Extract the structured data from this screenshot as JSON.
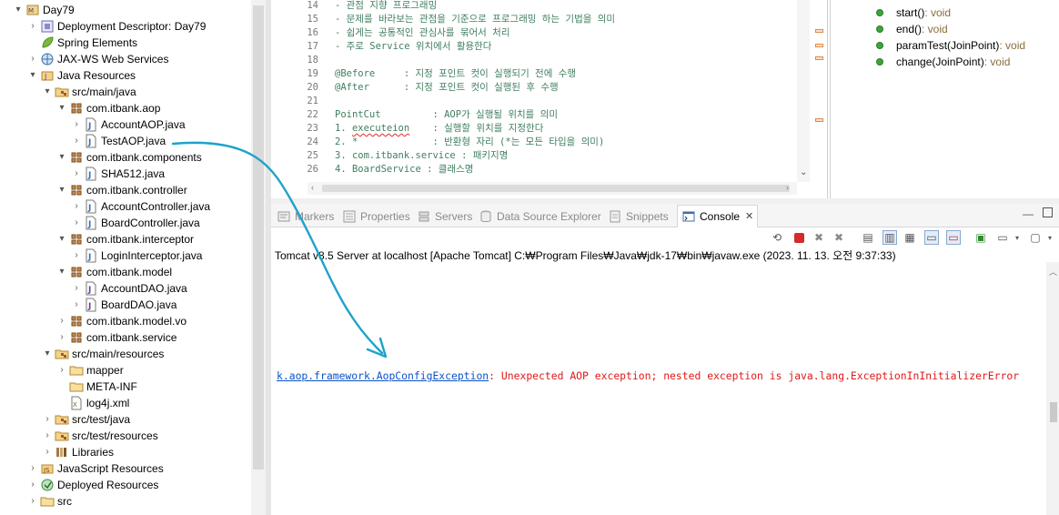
{
  "explorer": {
    "rows": [
      {
        "label": "Day79",
        "twisty": "▾",
        "icon": "project-icon"
      },
      {
        "label": "Deployment Descriptor: Day79",
        "twisty": "›",
        "icon": "deployment-descriptor-icon"
      },
      {
        "label": "Spring Elements",
        "twisty": "",
        "icon": "spring-leaf-icon"
      },
      {
        "label": "JAX-WS Web Services",
        "twisty": "›",
        "icon": "web-services-icon"
      },
      {
        "label": "Java Resources",
        "twisty": "▾",
        "icon": "java-resources-icon"
      },
      {
        "label": "src/main/java",
        "twisty": "▾",
        "icon": "source-folder-icon"
      },
      {
        "label": "com.itbank.aop",
        "twisty": "▾",
        "icon": "package-icon"
      },
      {
        "label": "AccountAOP.java",
        "twisty": "›",
        "icon": "java-file-icon"
      },
      {
        "label": "TestAOP.java",
        "twisty": "›",
        "icon": "java-file-icon"
      },
      {
        "label": "com.itbank.components",
        "twisty": "▾",
        "icon": "package-icon"
      },
      {
        "label": "SHA512.java",
        "twisty": "›",
        "icon": "java-file-icon"
      },
      {
        "label": "com.itbank.controller",
        "twisty": "▾",
        "icon": "package-icon"
      },
      {
        "label": "AccountController.java",
        "twisty": "›",
        "icon": "java-file-icon"
      },
      {
        "label": "BoardController.java",
        "twisty": "›",
        "icon": "java-file-icon"
      },
      {
        "label": "com.itbank.interceptor",
        "twisty": "▾",
        "icon": "package-icon"
      },
      {
        "label": "LoginInterceptor.java",
        "twisty": "›",
        "icon": "java-file-icon"
      },
      {
        "label": "com.itbank.model",
        "twisty": "▾",
        "icon": "package-icon"
      },
      {
        "label": "AccountDAO.java",
        "twisty": "›",
        "icon": "java-interface-icon"
      },
      {
        "label": "BoardDAO.java",
        "twisty": "›",
        "icon": "java-interface-icon"
      },
      {
        "label": "com.itbank.model.vo",
        "twisty": "›",
        "icon": "package-icon"
      },
      {
        "label": "com.itbank.service",
        "twisty": "›",
        "icon": "package-icon"
      },
      {
        "label": "src/main/resources",
        "twisty": "▾",
        "icon": "source-folder-icon"
      },
      {
        "label": "mapper",
        "twisty": "›",
        "icon": "folder-icon"
      },
      {
        "label": "META-INF",
        "twisty": "",
        "icon": "folder-icon"
      },
      {
        "label": "log4j.xml",
        "twisty": "",
        "icon": "xml-file-icon"
      },
      {
        "label": "src/test/java",
        "twisty": "›",
        "icon": "source-folder-icon"
      },
      {
        "label": "src/test/resources",
        "twisty": "›",
        "icon": "source-folder-icon"
      },
      {
        "label": "Libraries",
        "twisty": "›",
        "icon": "libraries-icon"
      },
      {
        "label": "JavaScript Resources",
        "twisty": "›",
        "icon": "javascript-resources-icon"
      },
      {
        "label": "Deployed Resources",
        "twisty": "›",
        "icon": "deployed-resources-icon"
      },
      {
        "label": "src",
        "twisty": "›",
        "icon": "folder-icon"
      }
    ]
  },
  "editor": {
    "lines": [
      {
        "num": "14",
        "text": "- 관점 지향 프로그래밍"
      },
      {
        "num": "15",
        "text": "- 문제를 바라보는 관점을 기준으로 프로그래밍 하는 기법을 의미"
      },
      {
        "num": "16",
        "text": "- 쉽게는 공통적인 관심사를 묶어서 처리"
      },
      {
        "num": "17",
        "text": "- 주로 Service 위치에서 활용한다"
      },
      {
        "num": "18",
        "text": ""
      },
      {
        "num": "19",
        "text": "@Before     : 지정 포인트 컷이 실행되기 전에 수행"
      },
      {
        "num": "20",
        "text": "@After      : 지정 포인트 컷이 실행된 후 수행"
      },
      {
        "num": "21",
        "text": ""
      },
      {
        "num": "22",
        "text": "PointCut         : AOP가 실행될 위치를 의미"
      },
      {
        "num": "23",
        "text": "1. executeion    : 실행할 위치를 지정한다"
      },
      {
        "num": "24",
        "text": "2. *             : 반환형 자리 (*는 모든 타입을 의미)"
      },
      {
        "num": "25",
        "text": "3. com.itbank.service : 패키지명"
      },
      {
        "num": "26",
        "text": "4. BoardService : 클래스명"
      }
    ]
  },
  "outline": {
    "items": [
      {
        "name": "start()",
        "type": " : void"
      },
      {
        "name": "end()",
        "type": " : void"
      },
      {
        "name": "paramTest(JoinPoint)",
        "type": " : void"
      },
      {
        "name": "change(JoinPoint)",
        "type": " : void"
      }
    ]
  },
  "views": {
    "tabs": [
      {
        "label": "Markers",
        "icon": "markers-icon",
        "active": false
      },
      {
        "label": "Properties",
        "icon": "properties-icon",
        "active": false
      },
      {
        "label": "Servers",
        "icon": "servers-icon",
        "active": false
      },
      {
        "label": "Data Source Explorer",
        "icon": "data-source-icon",
        "active": false
      },
      {
        "label": "Snippets",
        "icon": "snippets-icon",
        "active": false
      },
      {
        "label": "Console",
        "icon": "console-icon",
        "active": true
      }
    ],
    "console": {
      "title": "Tomcat v8.5 Server at localhost [Apache Tomcat] C:₩Program Files₩Java₩jdk-17₩bin₩javaw.exe (2023. 11. 13. 오전 9:37:33)",
      "error_link": "k.aop.framework.AopConfigException",
      "error_message": ": Unexpected AOP exception; nested exception is java.lang.ExceptionInInitializerError"
    }
  },
  "colors": {
    "comment_green": "#3f7f5f",
    "error_red": "#e01818",
    "link_blue": "#0b52c8",
    "annotation_arrow": "#1ea3c9"
  }
}
